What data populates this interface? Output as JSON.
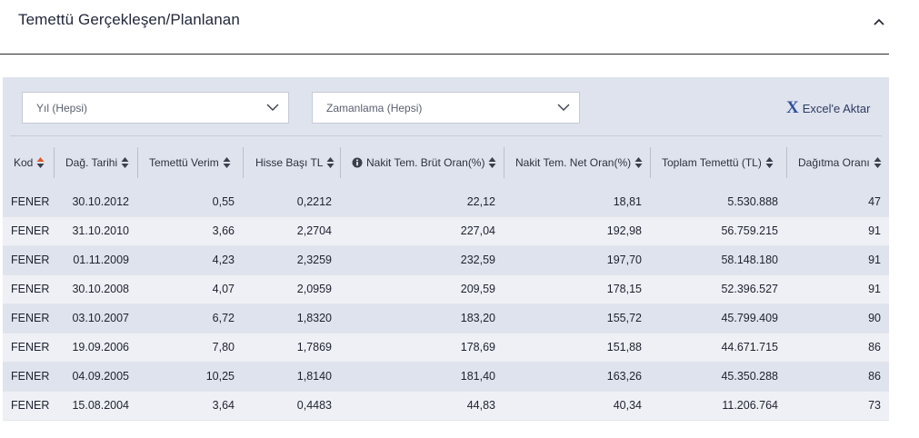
{
  "section": {
    "title": "Temettü Gerçekleşen/Planlanan"
  },
  "filters": {
    "year": "Yıl (Hepsi)",
    "timing": "Zamanlama (Hepsi)"
  },
  "export": {
    "icon": "excel-x-icon",
    "label": "Excel'e Aktar"
  },
  "table": {
    "columns": [
      "Kod",
      "Dağ. Tarihi",
      "Temettü Verim",
      "Hisse Başı TL",
      "Nakit Tem. Brüt Oran(%)",
      "Nakit Tem. Net Oran(%)",
      "Toplam Temettü (TL)",
      "Dağıtma Oranı"
    ],
    "rows": [
      [
        "FENER",
        "30.10.2012",
        "0,55",
        "0,2212",
        "22,12",
        "18,81",
        "5.530.888",
        "47"
      ],
      [
        "FENER",
        "31.10.2010",
        "3,66",
        "2,2704",
        "227,04",
        "192,98",
        "56.759.215",
        "91"
      ],
      [
        "FENER",
        "01.11.2009",
        "4,23",
        "2,3259",
        "232,59",
        "197,70",
        "58.148.180",
        "91"
      ],
      [
        "FENER",
        "30.10.2008",
        "4,07",
        "2,0959",
        "209,59",
        "178,15",
        "52.396.527",
        "91"
      ],
      [
        "FENER",
        "03.10.2007",
        "6,72",
        "1,8320",
        "183,20",
        "155,72",
        "45.799.409",
        "90"
      ],
      [
        "FENER",
        "19.09.2006",
        "7,80",
        "1,7869",
        "178,69",
        "151,88",
        "44.671.715",
        "86"
      ],
      [
        "FENER",
        "04.09.2005",
        "10,25",
        "1,8140",
        "181,40",
        "163,26",
        "45.350.288",
        "86"
      ],
      [
        "FENER",
        "15.08.2004",
        "3,64",
        "0,4483",
        "44,83",
        "40,34",
        "11.206.764",
        "73"
      ]
    ]
  },
  "colors": {
    "active_sort": "#e05a2b",
    "panel_bg": "#dfe3ed",
    "excel_icon": "#2f4f9e"
  }
}
